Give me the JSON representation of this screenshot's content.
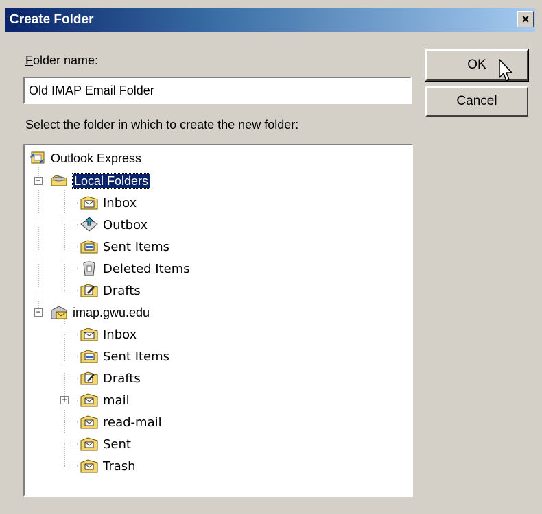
{
  "dialog": {
    "title": "Create Folder",
    "close_label": "×",
    "folder_name_label_accel": "F",
    "folder_name_label_rest": "older name:",
    "folder_name_value": "Old IMAP Email Folder",
    "select_label": "Select the folder in which to create the new folder:",
    "ok_label": "OK",
    "cancel_label": "Cancel"
  },
  "tree": {
    "root": {
      "label": "Outlook Express",
      "icon": "outlook-express-icon"
    },
    "local": {
      "label": "Local Folders",
      "icon": "local-folders-icon",
      "expanded": true,
      "selected": true,
      "children": [
        {
          "label": "Inbox",
          "icon": "inbox-icon"
        },
        {
          "label": "Outbox",
          "icon": "outbox-icon"
        },
        {
          "label": "Sent Items",
          "icon": "sent-items-icon"
        },
        {
          "label": "Deleted Items",
          "icon": "deleted-items-icon"
        },
        {
          "label": "Drafts",
          "icon": "drafts-icon"
        }
      ]
    },
    "imap": {
      "label": "imap.gwu.edu",
      "icon": "imap-server-icon",
      "expanded": true,
      "children": [
        {
          "label": "Inbox",
          "icon": "inbox-icon"
        },
        {
          "label": "Sent Items",
          "icon": "sent-items-icon"
        },
        {
          "label": "Drafts",
          "icon": "drafts-icon"
        },
        {
          "label": "mail",
          "icon": "folder-icon",
          "collapsed": true
        },
        {
          "label": "read-mail",
          "icon": "folder-icon"
        },
        {
          "label": "Sent",
          "icon": "folder-icon"
        },
        {
          "label": "Trash",
          "icon": "folder-icon"
        }
      ]
    }
  },
  "colors": {
    "face": "#d4d0c8",
    "titlebar_start": "#0a246a",
    "titlebar_end": "#a6caf0",
    "selection": "#0a246a",
    "folder_yellow": "#f5d76e"
  }
}
